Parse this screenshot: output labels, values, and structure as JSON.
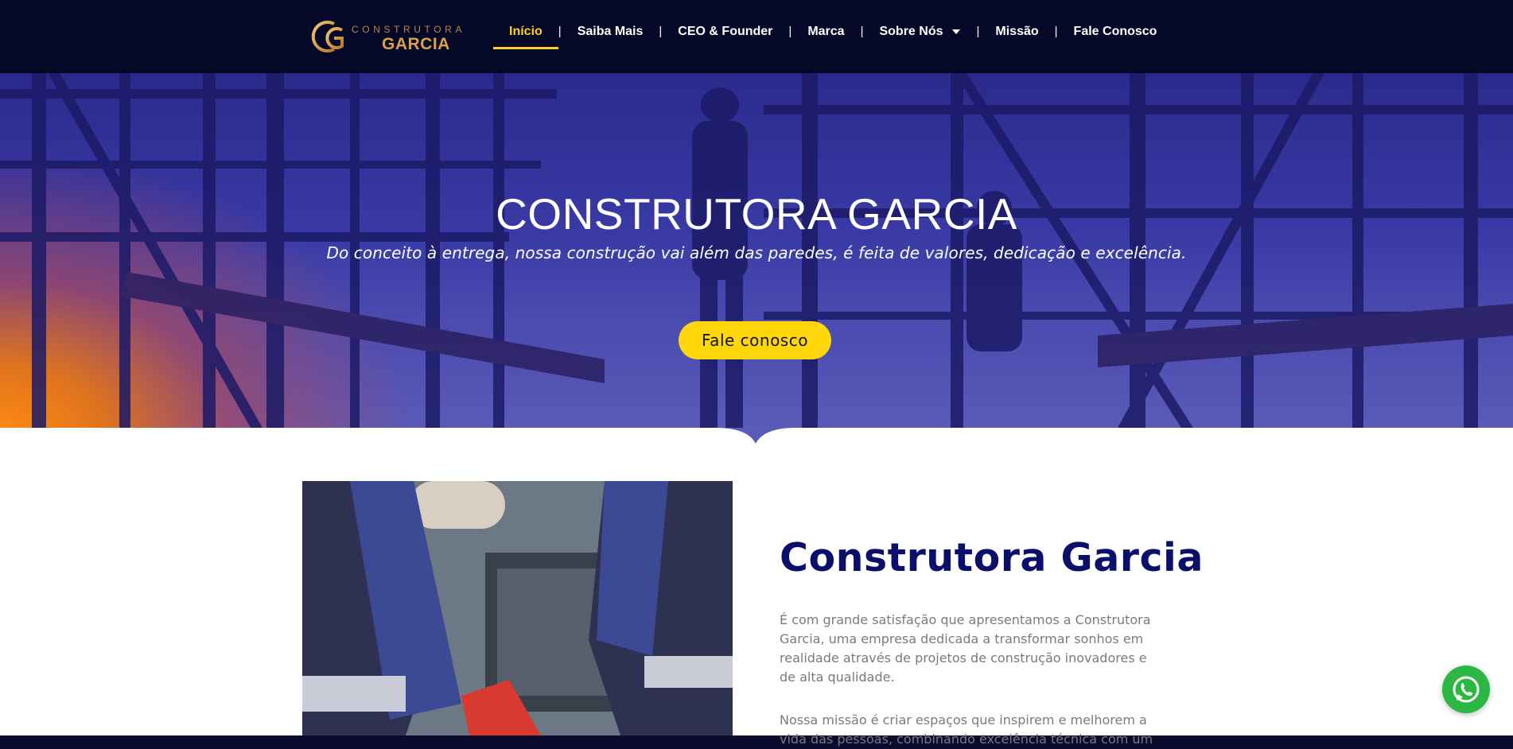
{
  "header": {
    "logo": {
      "top_text": "CONSTRUTORA",
      "bottom_text": "GARCIA",
      "icon": "cg-monogram-logo"
    },
    "nav": [
      {
        "label": "Início",
        "active": true
      },
      {
        "label": "Saiba Mais"
      },
      {
        "label": "CEO & Founder"
      },
      {
        "label": "Marca"
      },
      {
        "label": "Sobre Nós",
        "icon": "chevron-down-icon"
      },
      {
        "label": "Missão"
      },
      {
        "label": "Fale Conosco"
      }
    ],
    "separator": "|"
  },
  "hero": {
    "title": "CONSTRUTORA GARCIA",
    "subtitle": "Do conceito à entrega, nossa construção vai além das paredes, é feita de valores, dedicação e excelência.",
    "button_label": "Fale conosco"
  },
  "about": {
    "title": "Construtora Garcia",
    "paragraph1": "É com grande satisfação que apresentamos a Construtora Garcia, uma empresa dedicada a transformar sonhos em realidade através de projetos de construção inovadores e de alta qualidade.",
    "paragraph2": "Nossa missão é criar espaços que inspirem e melhorem a vida das pessoas, combinando excelência técnica com um"
  },
  "floating": {
    "icon": "whatsapp-icon"
  },
  "colors": {
    "header_bg": "#060828",
    "accent_yellow": "#ffd21a",
    "title_navy": "#0a0f6b",
    "whatsapp_green": "#2bb741"
  }
}
